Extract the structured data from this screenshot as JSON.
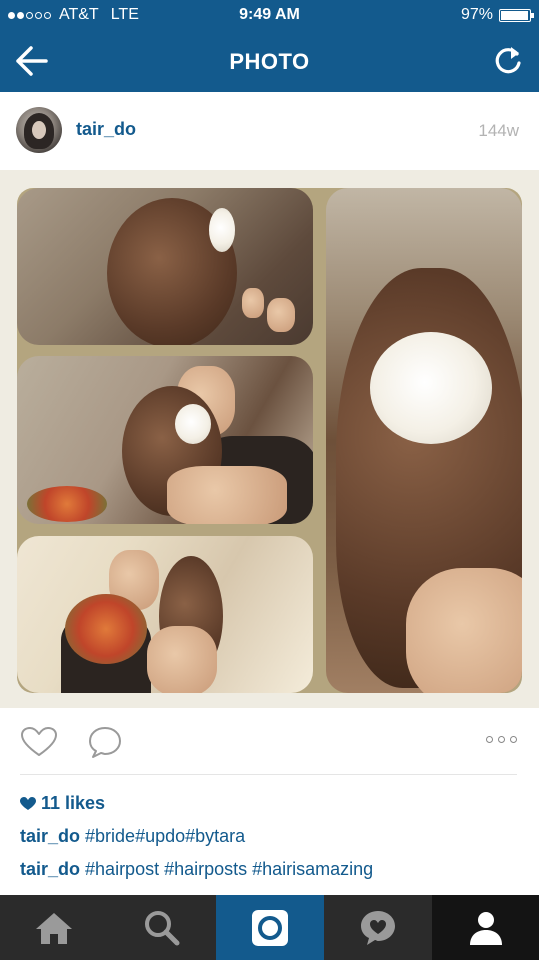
{
  "status_bar": {
    "carrier": "AT&T",
    "network": "LTE",
    "time": "9:49 AM",
    "battery": "97%",
    "battery_level": 0.97,
    "signal_bars_filled": 2,
    "signal_bars_total": 5
  },
  "nav": {
    "title": "PHOTO",
    "back_icon": "back-arrow-icon",
    "refresh_icon": "refresh-icon"
  },
  "post": {
    "username": "tair_do",
    "age": "144w",
    "likes": "11 likes",
    "captions": [
      {
        "user": "tair_do",
        "text": "#bride#updo#bytara"
      },
      {
        "user": "tair_do",
        "text": "#hairpost #hairposts #hairisamazing"
      }
    ]
  },
  "tabs": [
    "home-icon",
    "search-icon",
    "camera-icon",
    "activity-icon",
    "profile-icon"
  ],
  "colors": {
    "brand": "#135a8d",
    "tab_bar": "#2b2b2b",
    "active_tab": "#135a8d"
  }
}
